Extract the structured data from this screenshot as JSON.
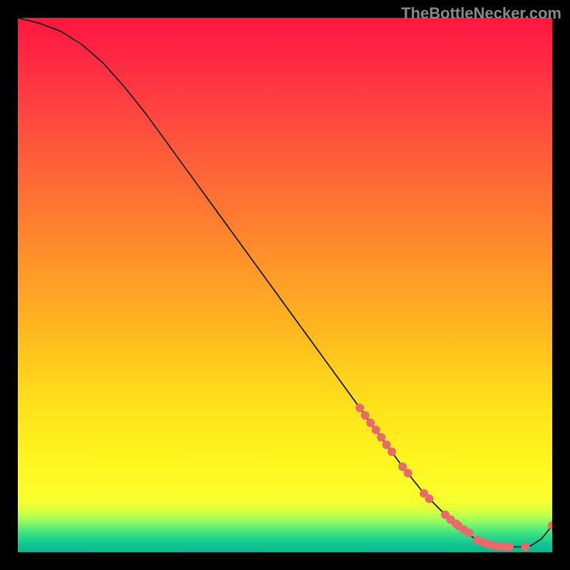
{
  "watermark": "TheBottleNecker.com",
  "chart_data": {
    "type": "line",
    "title": "",
    "xlabel": "",
    "ylabel": "",
    "xlim": [
      0,
      100
    ],
    "ylim": [
      0,
      100
    ],
    "background_gradient": {
      "top_color": "#ff1a4a",
      "mid_colors": [
        "#ff5a3a",
        "#ff9a30",
        "#ffd420",
        "#ffe820",
        "#fff820"
      ],
      "band_colors": [
        "#f0ff30",
        "#c0ff50",
        "#80ff60",
        "#30e880",
        "#10c890"
      ],
      "bottom_color": "#00b090"
    },
    "series": [
      {
        "name": "curve",
        "x": [
          0,
          4,
          8,
          12,
          16,
          20,
          24,
          28,
          32,
          36,
          40,
          44,
          48,
          52,
          56,
          60,
          64,
          68,
          72,
          76,
          80,
          84,
          86,
          88,
          90,
          92,
          94,
          96,
          98,
          100
        ],
        "values": [
          100,
          99,
          97.5,
          95,
          91.5,
          87,
          82,
          76.5,
          71,
          65.5,
          60,
          54.5,
          49,
          43.5,
          38,
          32.5,
          27,
          21.5,
          16,
          11,
          7,
          3.5,
          2.3,
          1.5,
          1.1,
          1.0,
          1.0,
          1.2,
          2.5,
          5.0
        ]
      }
    ],
    "markers": {
      "name": "markers",
      "color": "#e86a6a",
      "radius": 6,
      "x": [
        64,
        65,
        66,
        67,
        68,
        69,
        70,
        72,
        73,
        76,
        77,
        80,
        81,
        82,
        82.5,
        83.5,
        84.5,
        86,
        87,
        88,
        89,
        90,
        91,
        92,
        95,
        100
      ],
      "values": [
        27,
        25.6,
        24.2,
        22.9,
        21.5,
        20.1,
        18.8,
        16,
        14.8,
        11,
        10,
        7,
        6.1,
        5.3,
        4.9,
        4.2,
        3.6,
        2.3,
        1.9,
        1.5,
        1.3,
        1.1,
        1.05,
        1.0,
        1.0,
        5.0
      ]
    }
  }
}
